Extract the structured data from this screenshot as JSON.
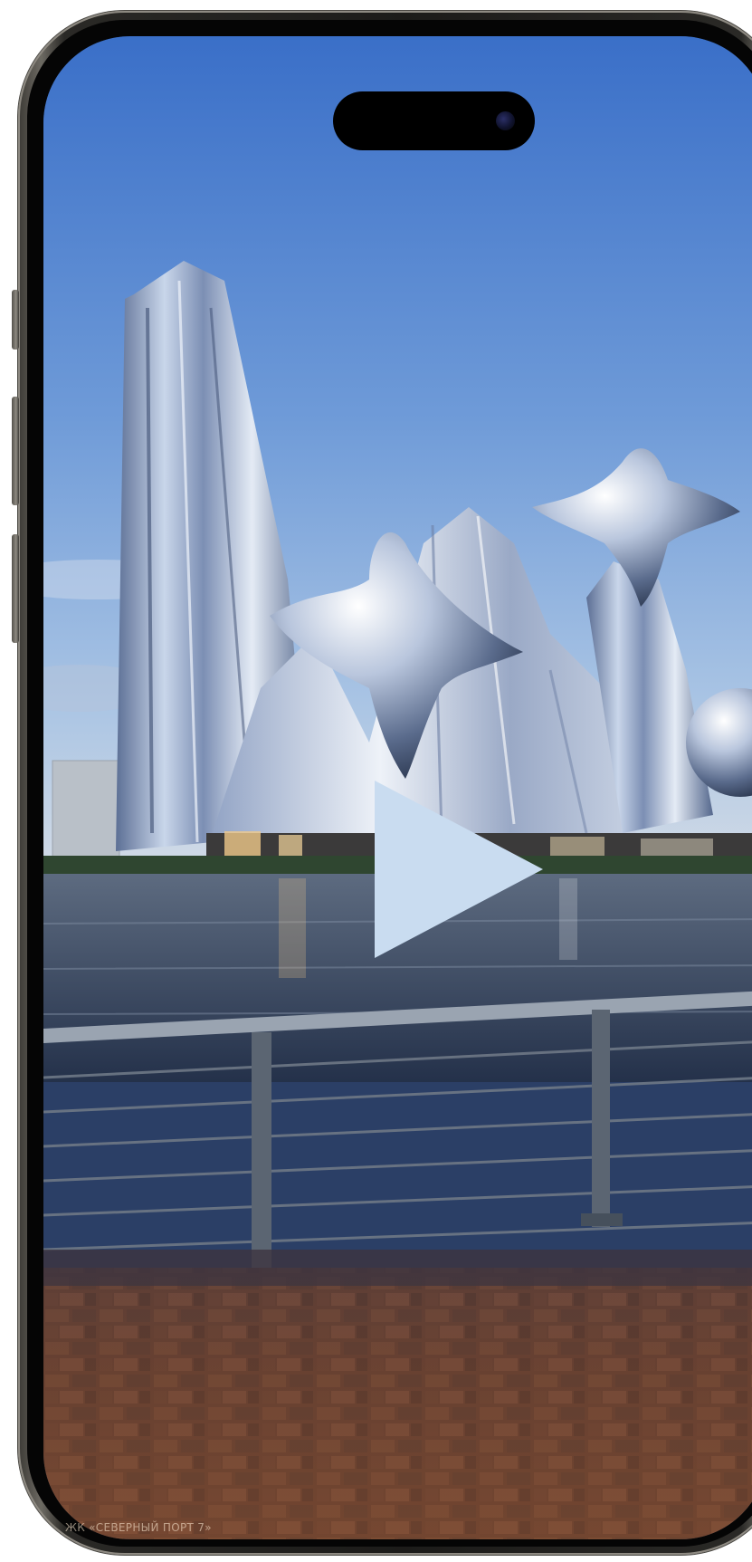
{
  "video": {
    "caption": "ЖК «СЕВЕРНЫЙ ПОРТ 7»",
    "state": "paused",
    "play_icon": "play-triangle-icon",
    "play_icon_color": "#c9dcf0"
  },
  "device": {
    "type": "smartphone",
    "frame_color": "#1c1b19",
    "camera_icon": "front-camera-icon"
  },
  "colors": {
    "sky_top": "#3f73c9",
    "sky_bottom": "#a9c6e6",
    "water": "#2f3f55",
    "pavement": "#6a3f2a"
  }
}
